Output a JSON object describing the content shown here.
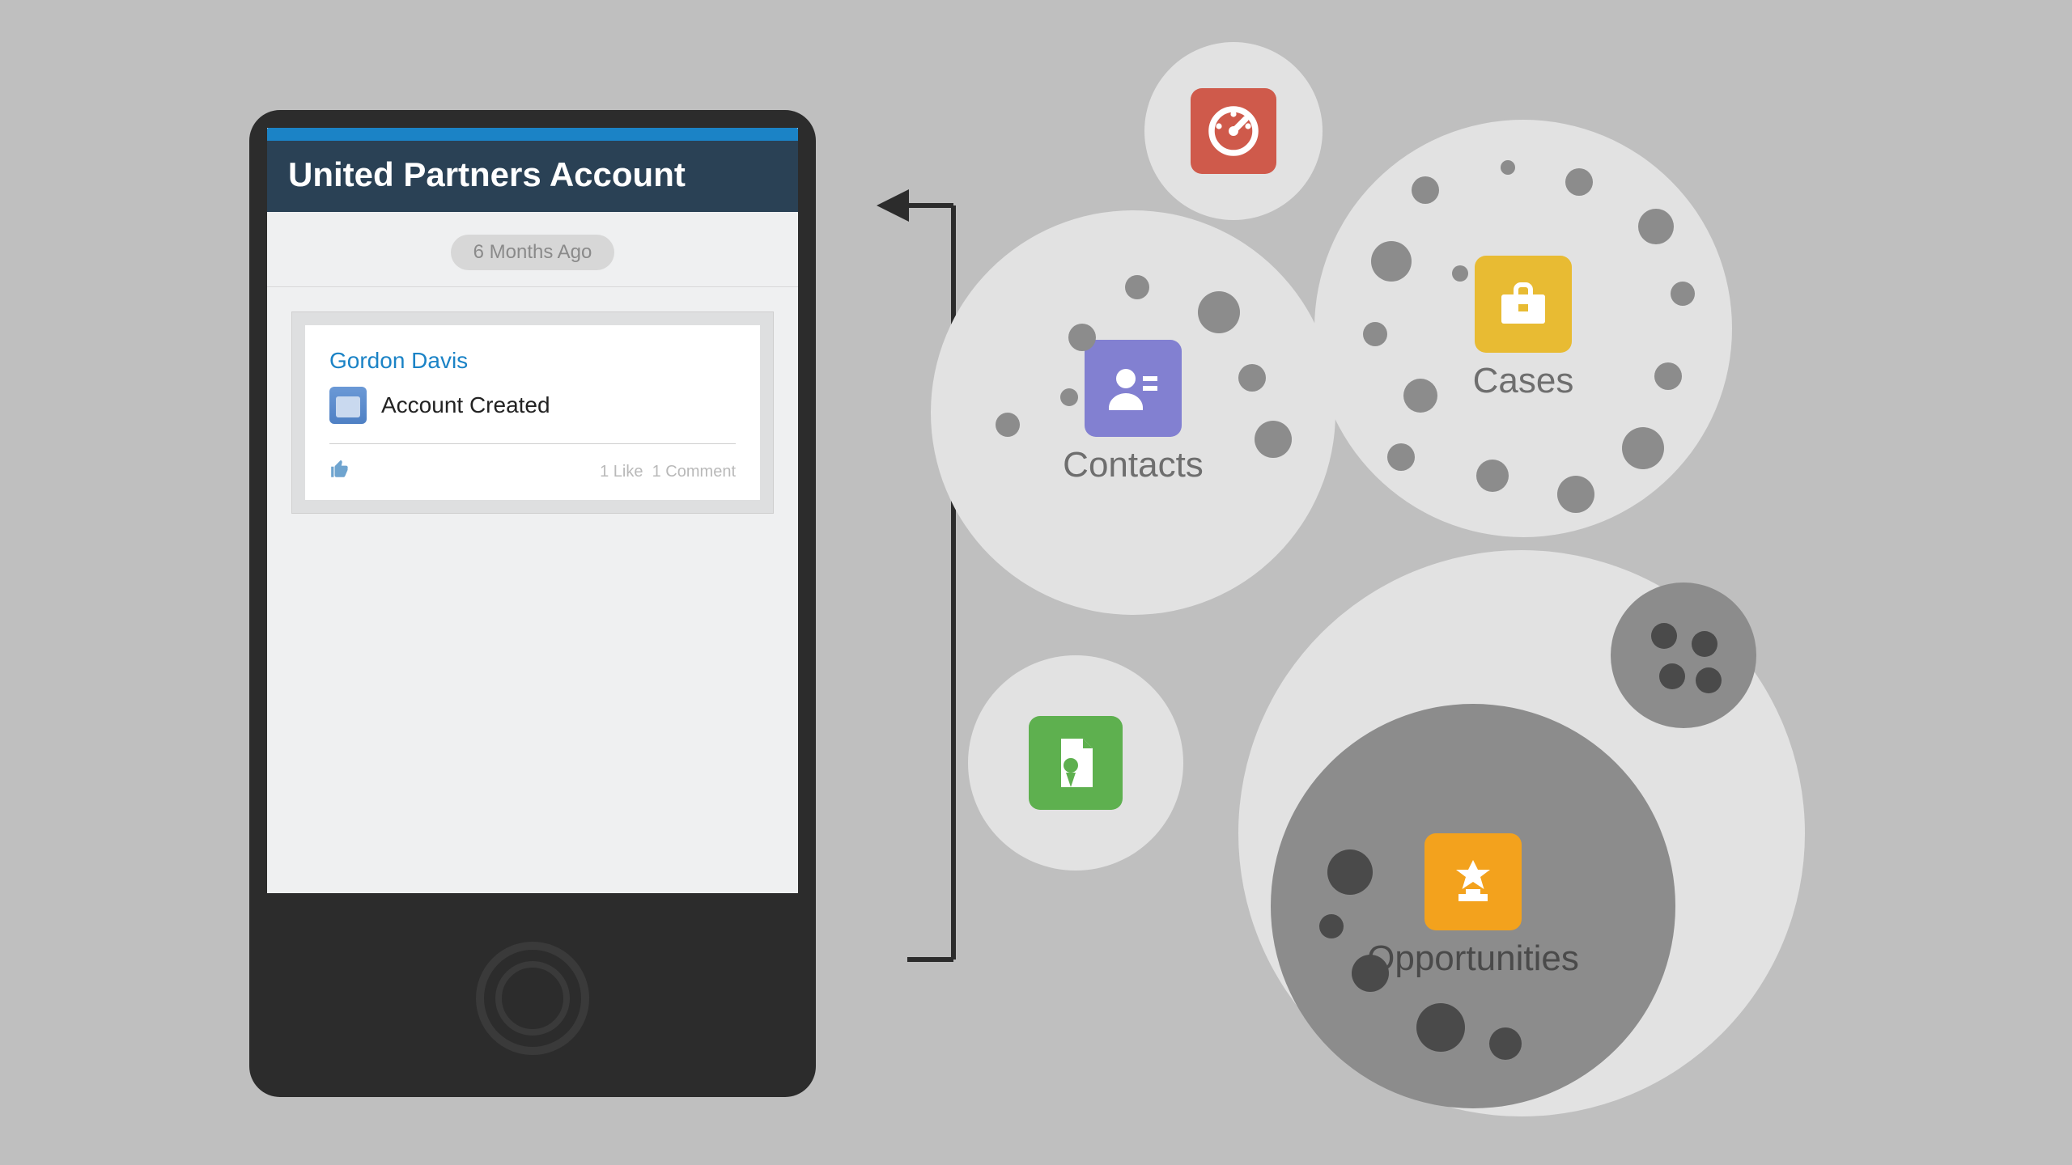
{
  "phone": {
    "title": "United Partners Account",
    "time_pill": "6 Months Ago",
    "card": {
      "author": "Gordon Davis",
      "activity": "Account Created",
      "likes_text": "1 Like",
      "comments_text": "1 Comment"
    }
  },
  "bubbles": {
    "contacts": {
      "label": "Contacts"
    },
    "cases": {
      "label": "Cases"
    },
    "opportunities": {
      "label": "Opportunities"
    }
  },
  "colors": {
    "contacts_icon": "#8280d1",
    "cases_icon": "#e8bb33",
    "doc_icon": "#5eb04f",
    "gauge_icon": "#cf5a4b",
    "opps_icon": "#f3a21d"
  }
}
